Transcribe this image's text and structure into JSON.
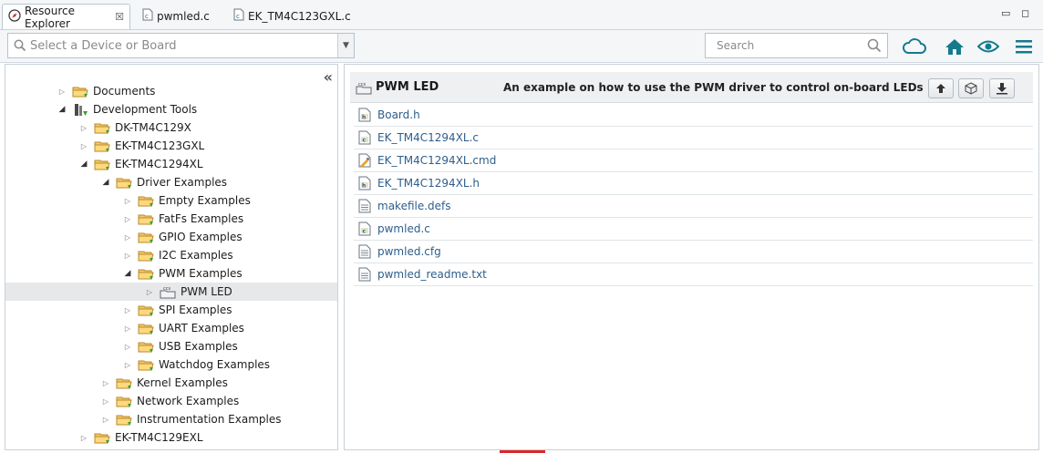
{
  "tabs": [
    {
      "label": "Resource Explorer",
      "close": "☒",
      "icon": "compass-icon"
    },
    {
      "label": "pwmled.c",
      "icon": "c-file-icon"
    },
    {
      "label": "EK_TM4C123GXL.c",
      "icon": "c-file-icon"
    }
  ],
  "window_controls": {
    "minimize": "▭",
    "maximize": "◻"
  },
  "toolbar": {
    "device_placeholder": "Select a Device or Board",
    "search_placeholder": "Search",
    "icons": [
      "cloud-icon",
      "home-icon",
      "eye-icon",
      "menu-icon"
    ]
  },
  "tree": {
    "collapse_label": "«",
    "items": [
      {
        "label": "Documents",
        "twisty": "▷",
        "icon": "folder-icon"
      },
      {
        "label": "Development Tools",
        "twisty": "◢",
        "icon": "tools-icon"
      },
      {
        "label": "DK-TM4C129X",
        "twisty": "▷",
        "icon": "folder-icon"
      },
      {
        "label": "EK-TM4C123GXL",
        "twisty": "▷",
        "icon": "folder-icon"
      },
      {
        "label": "EK-TM4C1294XL",
        "twisty": "◢",
        "icon": "folder-icon"
      },
      {
        "label": "Driver Examples",
        "twisty": "◢",
        "icon": "folder-icon"
      },
      {
        "label": "Empty Examples",
        "twisty": "▷",
        "icon": "folder-icon"
      },
      {
        "label": "FatFs Examples",
        "twisty": "▷",
        "icon": "folder-icon"
      },
      {
        "label": "GPIO Examples",
        "twisty": "▷",
        "icon": "folder-icon"
      },
      {
        "label": "I2C Examples",
        "twisty": "▷",
        "icon": "folder-icon"
      },
      {
        "label": "PWM Examples",
        "twisty": "◢",
        "icon": "folder-icon"
      },
      {
        "label": "PWM LED",
        "twisty": "▷",
        "icon": "ccs-project-icon"
      },
      {
        "label": "SPI Examples",
        "twisty": "▷",
        "icon": "folder-icon"
      },
      {
        "label": "UART Examples",
        "twisty": "▷",
        "icon": "folder-icon"
      },
      {
        "label": "USB Examples",
        "twisty": "▷",
        "icon": "folder-icon"
      },
      {
        "label": "Watchdog Examples",
        "twisty": "▷",
        "icon": "folder-icon"
      },
      {
        "label": "Kernel Examples",
        "twisty": "▷",
        "icon": "folder-icon"
      },
      {
        "label": "Network Examples",
        "twisty": "▷",
        "icon": "folder-icon"
      },
      {
        "label": "Instrumentation Examples",
        "twisty": "▷",
        "icon": "folder-icon"
      },
      {
        "label": "EK-TM4C129EXL",
        "twisty": "▷",
        "icon": "folder-icon"
      }
    ]
  },
  "detail": {
    "title": "PWM LED",
    "description": "An example on how to use the PWM driver to control on-board LEDs",
    "actions": [
      "up-arrow-icon",
      "package-icon",
      "download-icon"
    ],
    "files": [
      {
        "name": "Board.h",
        "icon": "h-file-icon"
      },
      {
        "name": "EK_TM4C1294XL.c",
        "icon": "c-file-icon"
      },
      {
        "name": "EK_TM4C1294XL.cmd",
        "icon": "cmd-file-icon"
      },
      {
        "name": "EK_TM4C1294XL.h",
        "icon": "h-file-icon"
      },
      {
        "name": "makefile.defs",
        "icon": "text-file-icon"
      },
      {
        "name": "pwmled.c",
        "icon": "c-file-icon"
      },
      {
        "name": "pwmled.cfg",
        "icon": "text-file-icon"
      },
      {
        "name": "pwmled_readme.txt",
        "icon": "text-file-icon"
      }
    ]
  },
  "colors": {
    "accent": "#147b8c",
    "link": "#2d5e8c"
  }
}
